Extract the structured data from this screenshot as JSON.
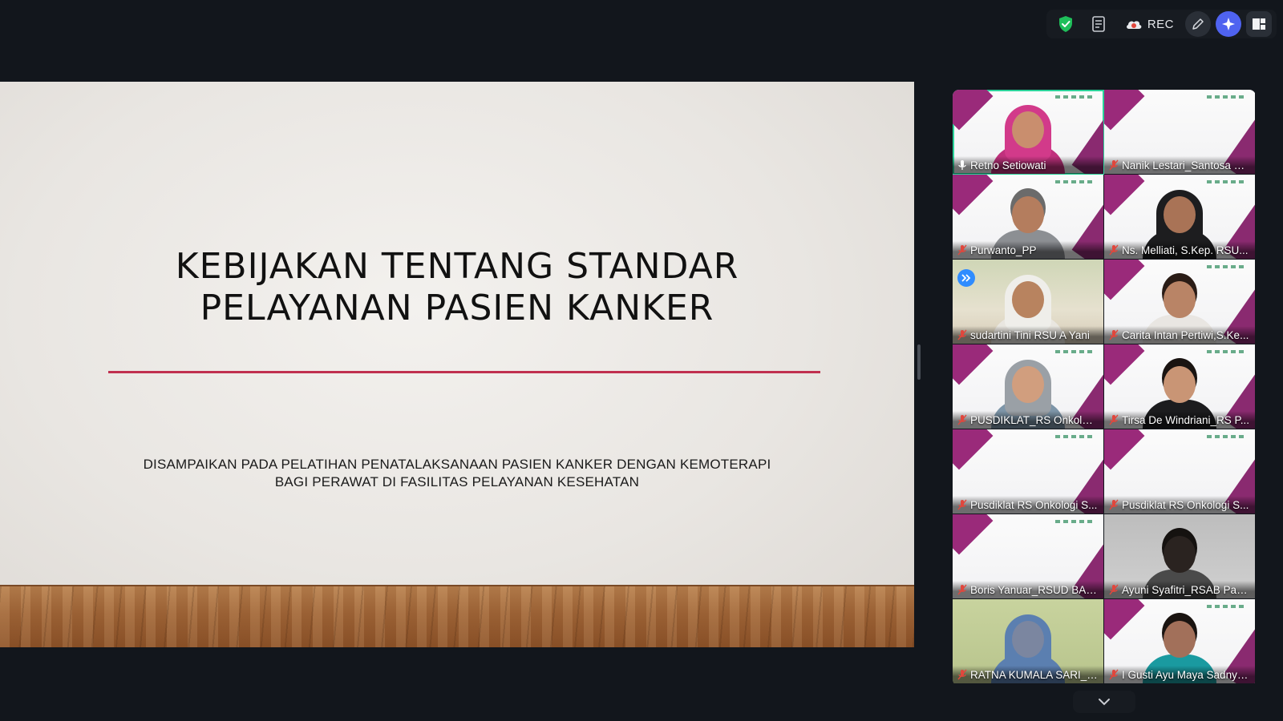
{
  "toolbar": {
    "security_icon": "shield-check-icon",
    "transcript_icon": "transcript-icon",
    "rec_label": "REC",
    "rec_icon": "cloud-record-icon",
    "annotate_icon": "pencil-icon",
    "ai_icon": "sparkle-icon",
    "layout_icon": "layout-icon"
  },
  "slide": {
    "title_line1": "KEBIJAKAN TENTANG STANDAR",
    "title_line2": "PELAYANAN PASIEN KANKER",
    "subtitle_line1": "DISAMPAIKAN PADA PELATIHAN PENATALAKSANAAN PASIEN KANKER DENGAN KEMOTERAPI",
    "subtitle_line2": "BAGI PERAWAT DI FASILITAS PELAYANAN KESEHATAN",
    "rule_color": "#c0304f"
  },
  "participants": [
    {
      "name": "Retno Setiowati",
      "muted": false,
      "active": true,
      "video": "hijab-pink"
    },
    {
      "name": "Nanik Lestari_Santosa H...",
      "muted": true,
      "active": false,
      "video": "background"
    },
    {
      "name": "Purwanto_PP",
      "muted": true,
      "active": false,
      "video": "man-grey"
    },
    {
      "name": "Ns. Melliati, S.Kep. RSU...",
      "muted": true,
      "active": false,
      "video": "hijab-black"
    },
    {
      "name": "sudartini Tini RSU A Yani",
      "muted": true,
      "active": false,
      "video": "hijab-white"
    },
    {
      "name": "Carita Intan Pertiwi,S.Ke...",
      "muted": true,
      "active": false,
      "video": "woman-plain"
    },
    {
      "name": "PUSDIKLAT_RS Onkologi...",
      "muted": true,
      "active": false,
      "video": "hijab-grey"
    },
    {
      "name": "Tirsa De Windriani_RS P...",
      "muted": true,
      "active": false,
      "video": "woman-dark"
    },
    {
      "name": "Pusdiklat RS Onkologi S...",
      "muted": true,
      "active": false,
      "video": "background"
    },
    {
      "name": "Pusdiklat RS Onkologi S...",
      "muted": true,
      "active": false,
      "video": "background"
    },
    {
      "name": "Boris Yanuar_RSUD BAK...",
      "muted": true,
      "active": false,
      "video": "background"
    },
    {
      "name": "Ayuni Syafitri_RSAB Pana...",
      "muted": true,
      "active": false,
      "video": "room-grey"
    },
    {
      "name": "RATNA KUMALA SARI_U...",
      "muted": true,
      "active": false,
      "video": "hijab-blue"
    },
    {
      "name": "I Gusti Ayu Maya Sadnyawa...",
      "muted": true,
      "active": false,
      "video": "woman-teal"
    }
  ],
  "pin_badge_icon": "fast-forward-icon",
  "scroll_icon": "chevron-down-icon",
  "colors": {
    "background": "#12161c",
    "active_speaker": "#2bd39a",
    "accent_ai": "#4f63f0",
    "muted_mic": "#e0473d",
    "brand_magenta": "#9a2a7a"
  }
}
